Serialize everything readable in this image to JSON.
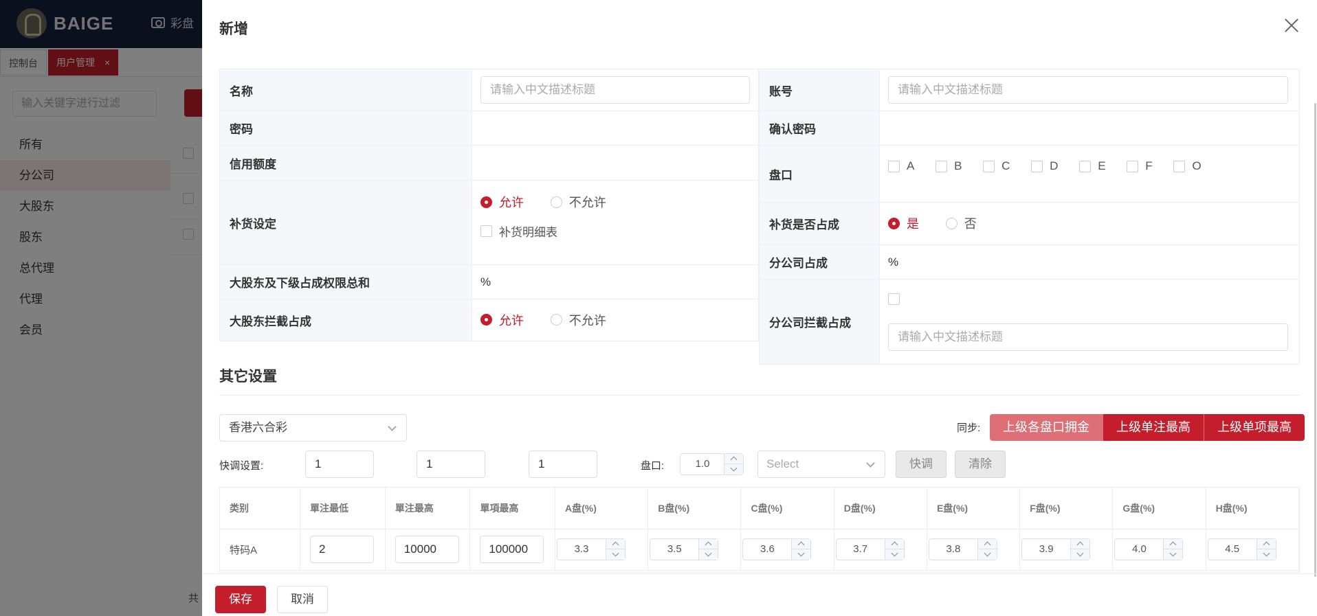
{
  "app": {
    "logo_text": "BAIGE",
    "nav_item": "彩盘",
    "tabs": [
      {
        "label": "控制台"
      },
      {
        "label": "用户管理",
        "close": "×"
      }
    ],
    "filter_placeholder": "输入关键字进行过滤",
    "sidebar": [
      "所有",
      "分公司",
      "大股东",
      "股东",
      "总代理",
      "代理",
      "会员"
    ],
    "footer_text": "共"
  },
  "drawer": {
    "title": "新增",
    "form": {
      "name_label": "名称",
      "name_placeholder": "请输入中文描述标题",
      "account_label": "账号",
      "account_placeholder": "请输入中文描述标题",
      "password_label": "密码",
      "confirm_password_label": "确认密码",
      "credit_label": "信用额度",
      "pankou_label": "盘口",
      "pankou_options": [
        "A",
        "B",
        "C",
        "D",
        "E",
        "F",
        "O"
      ],
      "restock_label": "补货设定",
      "allow": "允许",
      "disallow": "不允许",
      "restock_detail": "补货明细表",
      "restock_share_label": "补货是否占成",
      "yes": "是",
      "no": "否",
      "branch_share_label": "分公司占成",
      "percent": "%",
      "major_total_label": "大股东及下级占成权限总和",
      "major_intercept_label": "大股东拦截占成",
      "branch_intercept_label": "分公司拦截占成",
      "branch_intercept_placeholder": "请输入中文描述标题"
    },
    "other": {
      "title": "其它设置",
      "game": "香港六合彩",
      "sync_label": "同步:",
      "sync_buttons": [
        "上级各盘口拥金",
        "上级单注最高",
        "上级单项最高"
      ],
      "quick_label": "快调设置:",
      "quick_values": [
        "1",
        "1",
        "1"
      ],
      "pan_label": "盘口:",
      "pan_value": "1.0",
      "select_placeholder": "Select",
      "quick_btn": "快调",
      "clear_btn": "清除"
    },
    "table": {
      "headers": [
        "类别",
        "單注最低",
        "單注最高",
        "單項最高",
        "A盘(%)",
        "B盘(%)",
        "C盘(%)",
        "D盘(%)",
        "E盘(%)",
        "F盘(%)",
        "G盘(%)",
        "H盘(%)"
      ],
      "row": {
        "category": "特码A",
        "min": "2",
        "max": "10000",
        "item_max": "100000",
        "rates": [
          "3.3",
          "3.5",
          "3.6",
          "3.7",
          "3.8",
          "3.9",
          "4.0",
          "4.5"
        ]
      }
    },
    "save": "保存",
    "cancel": "取消"
  },
  "colors": {
    "accent": "#c41d2b",
    "accent_light": "#de6f76",
    "topbar": "#16213d"
  }
}
